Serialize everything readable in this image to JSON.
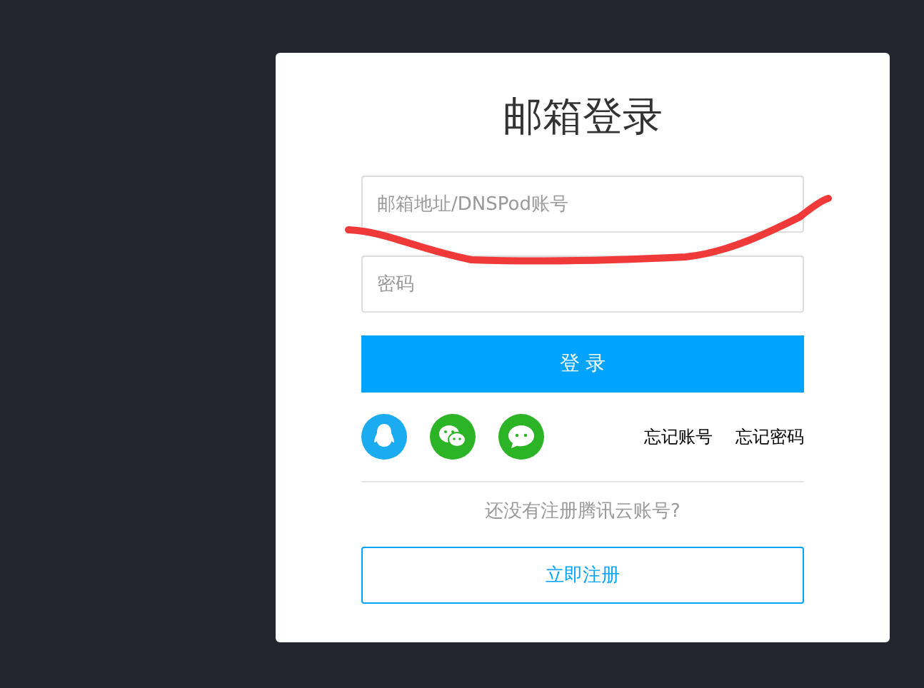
{
  "login_card": {
    "title": "邮箱登录",
    "fields": [
      {
        "placeholder": "邮箱地址/DNSPod账号"
      },
      {
        "placeholder": "密码"
      }
    ],
    "login_button": "登 录",
    "social_logins": [
      {
        "kind": "qq",
        "color": "#1aabf0"
      },
      {
        "kind": "wechat",
        "color": "#2bb425"
      },
      {
        "kind": "chat",
        "color": "#2bb425"
      }
    ],
    "links": [
      "忘记账号",
      "忘记密码"
    ],
    "register_prompt": "还没有注册腾讯云账号?",
    "register_button": "立即注册"
  }
}
